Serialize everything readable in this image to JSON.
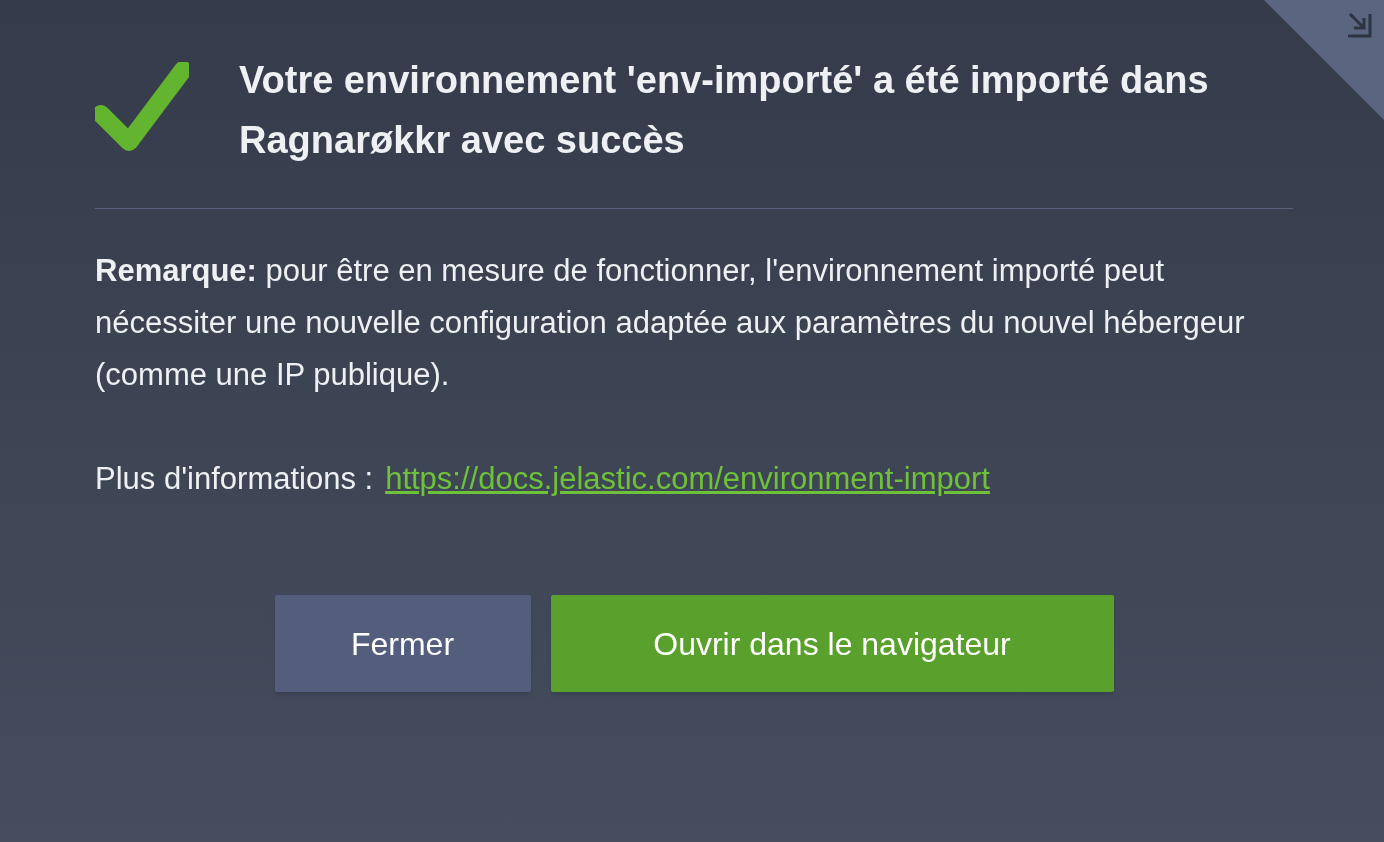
{
  "title": "Votre environnement 'env-importé' a été importé dans Ragnarøkkr avec succès",
  "note": "**Remarque:** pour être en mesure de fonctionner, l'environnement importé peut nécessiter une nouvelle configuration adaptée aux paramètres du nouvel hébergeur (comme une IP publique).",
  "more_info": {
    "label": "Plus d'informations :",
    "link": "https://docs.jelastic.com/environment-import"
  },
  "buttons": [
    {
      "label": "Fermer",
      "kind": "secondary"
    },
    {
      "label": "Ouvrir dans le navigateur",
      "kind": "primary"
    }
  ]
}
